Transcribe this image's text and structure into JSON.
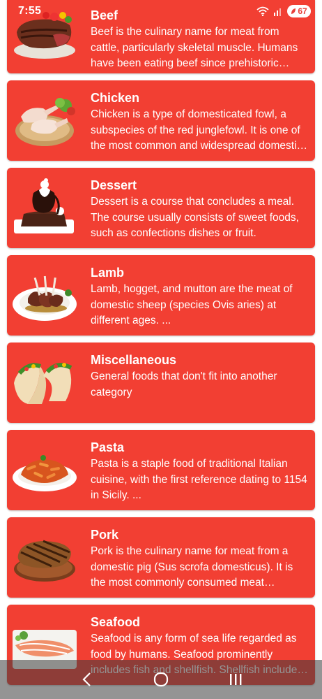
{
  "status_bar": {
    "time": "7:55",
    "battery": "67",
    "icons": [
      "wifi-icon",
      "signal-icon",
      "battery-saver-icon"
    ]
  },
  "categories": [
    {
      "name": "Beef",
      "description": "Beef is the culinary name for meat from cattle, particularly skeletal muscle. Humans have been eating beef since prehistoric times.",
      "image": "beef-photo"
    },
    {
      "name": "Chicken",
      "description": "Chicken is a type of domesticated fowl, a subspecies of the red junglefowl. It is one of the most common and widespread domestic animals.",
      "image": "chicken-photo"
    },
    {
      "name": "Dessert",
      "description": "Dessert is a course that concludes a meal. The course usually consists of sweet foods, such as confections dishes or fruit.",
      "image": "dessert-photo"
    },
    {
      "name": "Lamb",
      "description": "Lamb, hogget, and mutton are the meat of domestic sheep (species Ovis aries) at different ages. ...",
      "image": "lamb-photo"
    },
    {
      "name": "Miscellaneous",
      "description": "General foods that don't fit into another category",
      "image": "tacos-photo"
    },
    {
      "name": "Pasta",
      "description": "Pasta is a staple food of traditional Italian cuisine, with the first reference dating to 1154 in Sicily. ...",
      "image": "pasta-photo"
    },
    {
      "name": "Pork",
      "description": "Pork is the culinary name for meat from a domestic pig (Sus scrofa domesticus). It is the most commonly consumed meat worldwide.",
      "image": "pork-photo"
    },
    {
      "name": "Seafood",
      "description": "Seafood is any form of sea life regarded as food by humans. Seafood prominently includes fish and shellfish. Shellfish include various species.",
      "image": "seafood-photo"
    }
  ],
  "nav_bar": {
    "buttons": [
      "back-icon",
      "home-icon",
      "recents-icon"
    ]
  },
  "colors": {
    "card": "#f23f33",
    "text": "#ffffff"
  }
}
